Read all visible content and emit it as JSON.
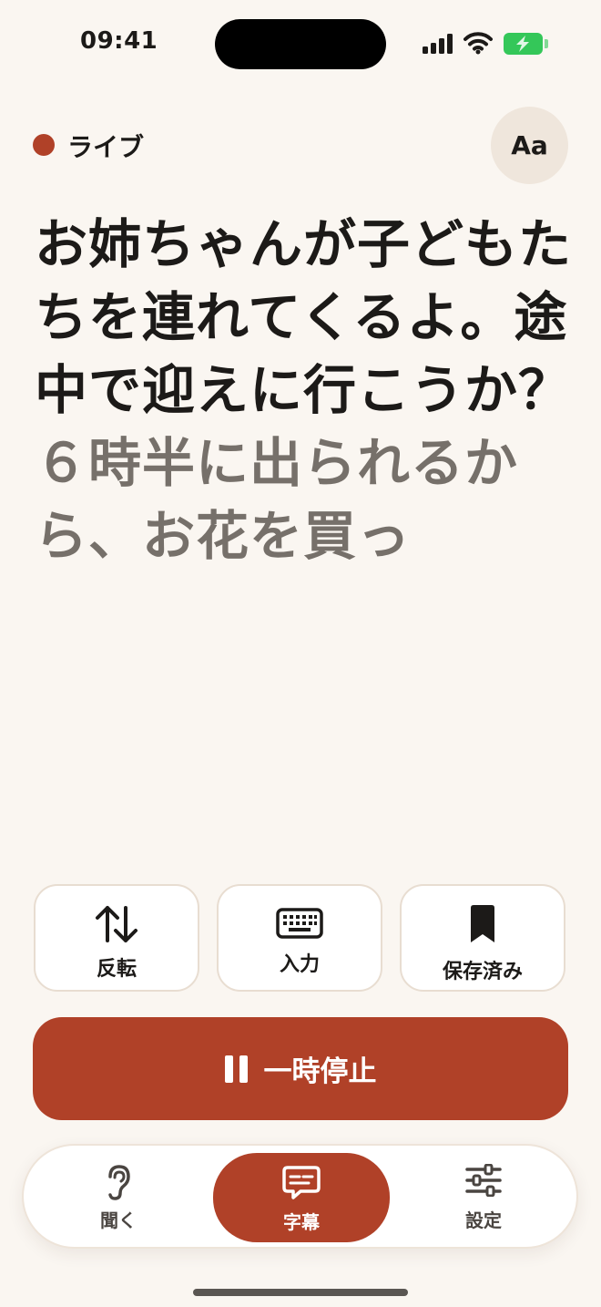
{
  "status_bar": {
    "time": "09:41"
  },
  "header": {
    "live_label": "ライブ",
    "font_button_label": "Aa"
  },
  "transcript": {
    "final_text": "お姉ちゃんが子どもたちを連れてくるよ。途中で迎えに行こうか？",
    "interim_text": "６時半に出られるから、お花を買っ"
  },
  "actions": [
    {
      "label": "反転",
      "icon": "swap-vertical-icon"
    },
    {
      "label": "入力",
      "icon": "keyboard-icon"
    },
    {
      "label": "保存済み",
      "icon": "bookmark-icon"
    }
  ],
  "pause_button": {
    "label": "一時停止",
    "icon": "pause-icon"
  },
  "tabs": [
    {
      "label": "聞く",
      "icon": "ear-icon",
      "active": false
    },
    {
      "label": "字幕",
      "icon": "caption-bubble-icon",
      "active": true
    },
    {
      "label": "設定",
      "icon": "sliders-icon",
      "active": false
    }
  ],
  "colors": {
    "accent": "#b04128",
    "background": "#faf6f1",
    "interim_text": "#76706a",
    "battery": "#34c759"
  }
}
